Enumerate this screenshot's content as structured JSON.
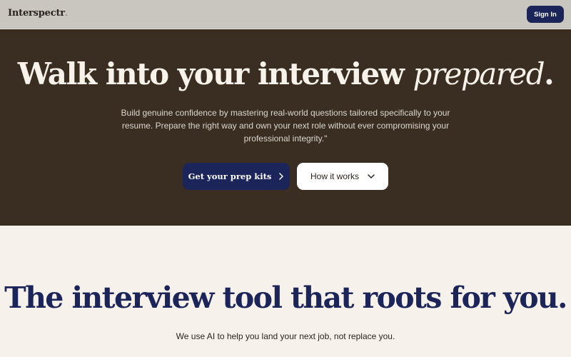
{
  "header": {
    "logo_text": "Interspectr",
    "logo_dot": ".",
    "signin_label": "Sign In"
  },
  "hero": {
    "title_main": "Walk into your interview ",
    "title_emphasis": "prepared",
    "title_end": ".",
    "subtitle": "Build genuine confidence by mastering real-world questions tailored specifically to your resume. Prepare the right way and own your next role without ever compromising your professional integrity.\"",
    "primary_cta": "Get your prep kits",
    "secondary_cta": "How it works"
  },
  "section": {
    "title": "The interview tool that roots for you.",
    "subtitle": "We use AI to help you land your next job, not replace you."
  },
  "icons": {
    "primary_cta_icon": "chevron-right-icon",
    "secondary_cta_icon": "chevron-down-icon"
  },
  "colors": {
    "navy": "#1c2559",
    "hero_bg": "#3a2d22",
    "topbar_bg": "#c9c5bf",
    "page_bg": "#f6f1ea"
  }
}
